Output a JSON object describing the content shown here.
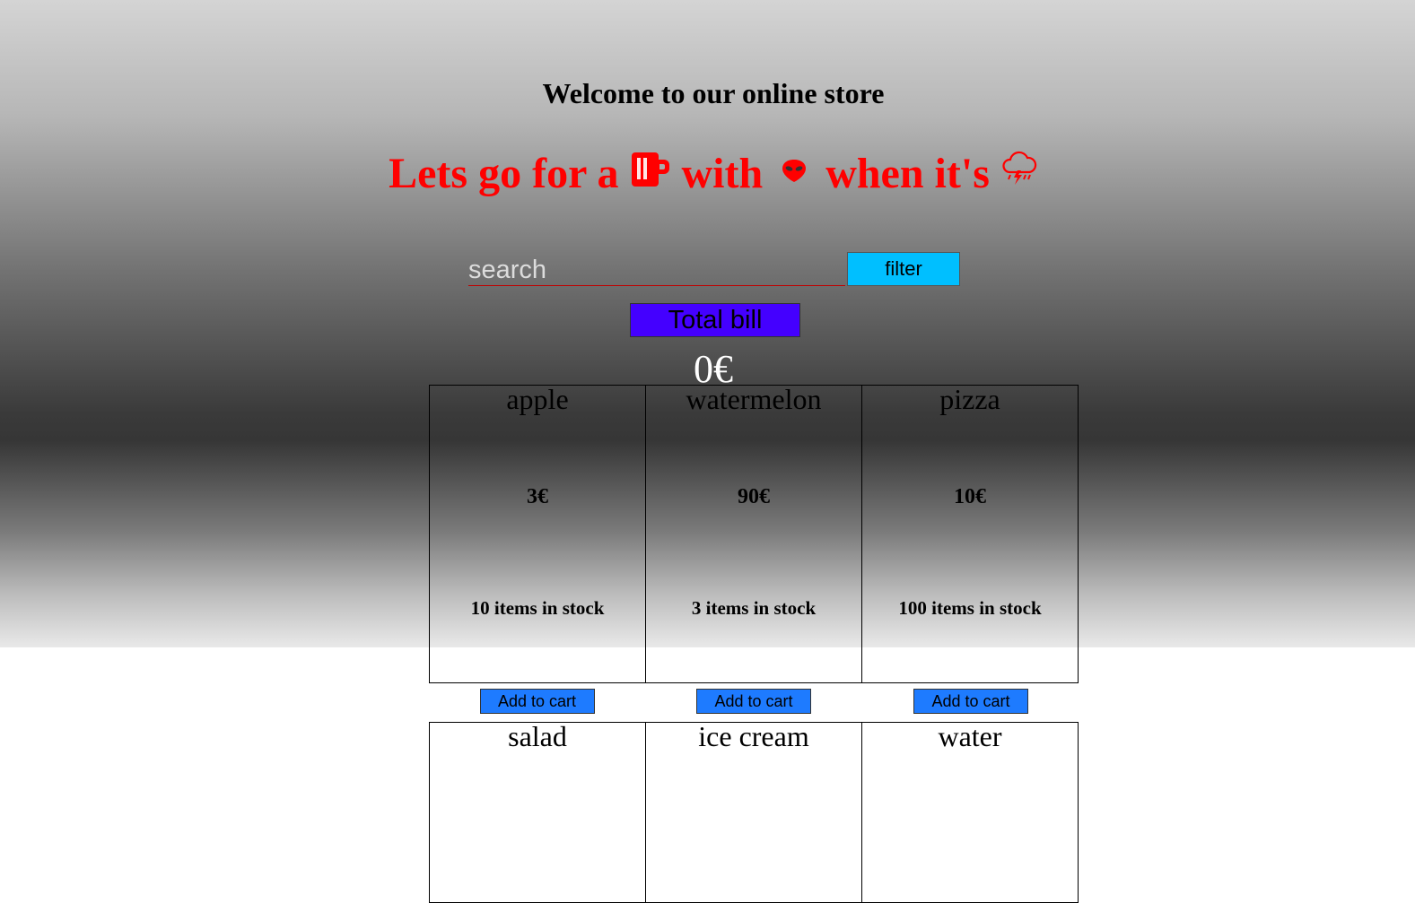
{
  "header": {
    "welcome": "Welcome to our online store",
    "tagline_part1": "Lets go for a",
    "tagline_part2": "with",
    "tagline_part3": "when it's",
    "icons": [
      "beer-mug-icon",
      "alien-icon",
      "storm-cloud-icon"
    ],
    "accent_color": "#ff0000"
  },
  "search": {
    "placeholder": "search",
    "filter_label": "filter"
  },
  "bill": {
    "button_label": "Total bill",
    "amount": "0€"
  },
  "products": [
    {
      "name": "apple",
      "price": "3€",
      "stock": "10 items in stock",
      "button": "Add to cart"
    },
    {
      "name": "watermelon",
      "price": "90€",
      "stock": "3 items in stock",
      "button": "Add to cart"
    },
    {
      "name": "pizza",
      "price": "10€",
      "stock": "100 items in stock",
      "button": "Add to cart"
    },
    {
      "name": "salad"
    },
    {
      "name": "ice cream"
    },
    {
      "name": "water"
    }
  ],
  "colors": {
    "filter_button": "#00bfff",
    "total_button": "#4400ff",
    "cart_button": "#1e7bff"
  }
}
